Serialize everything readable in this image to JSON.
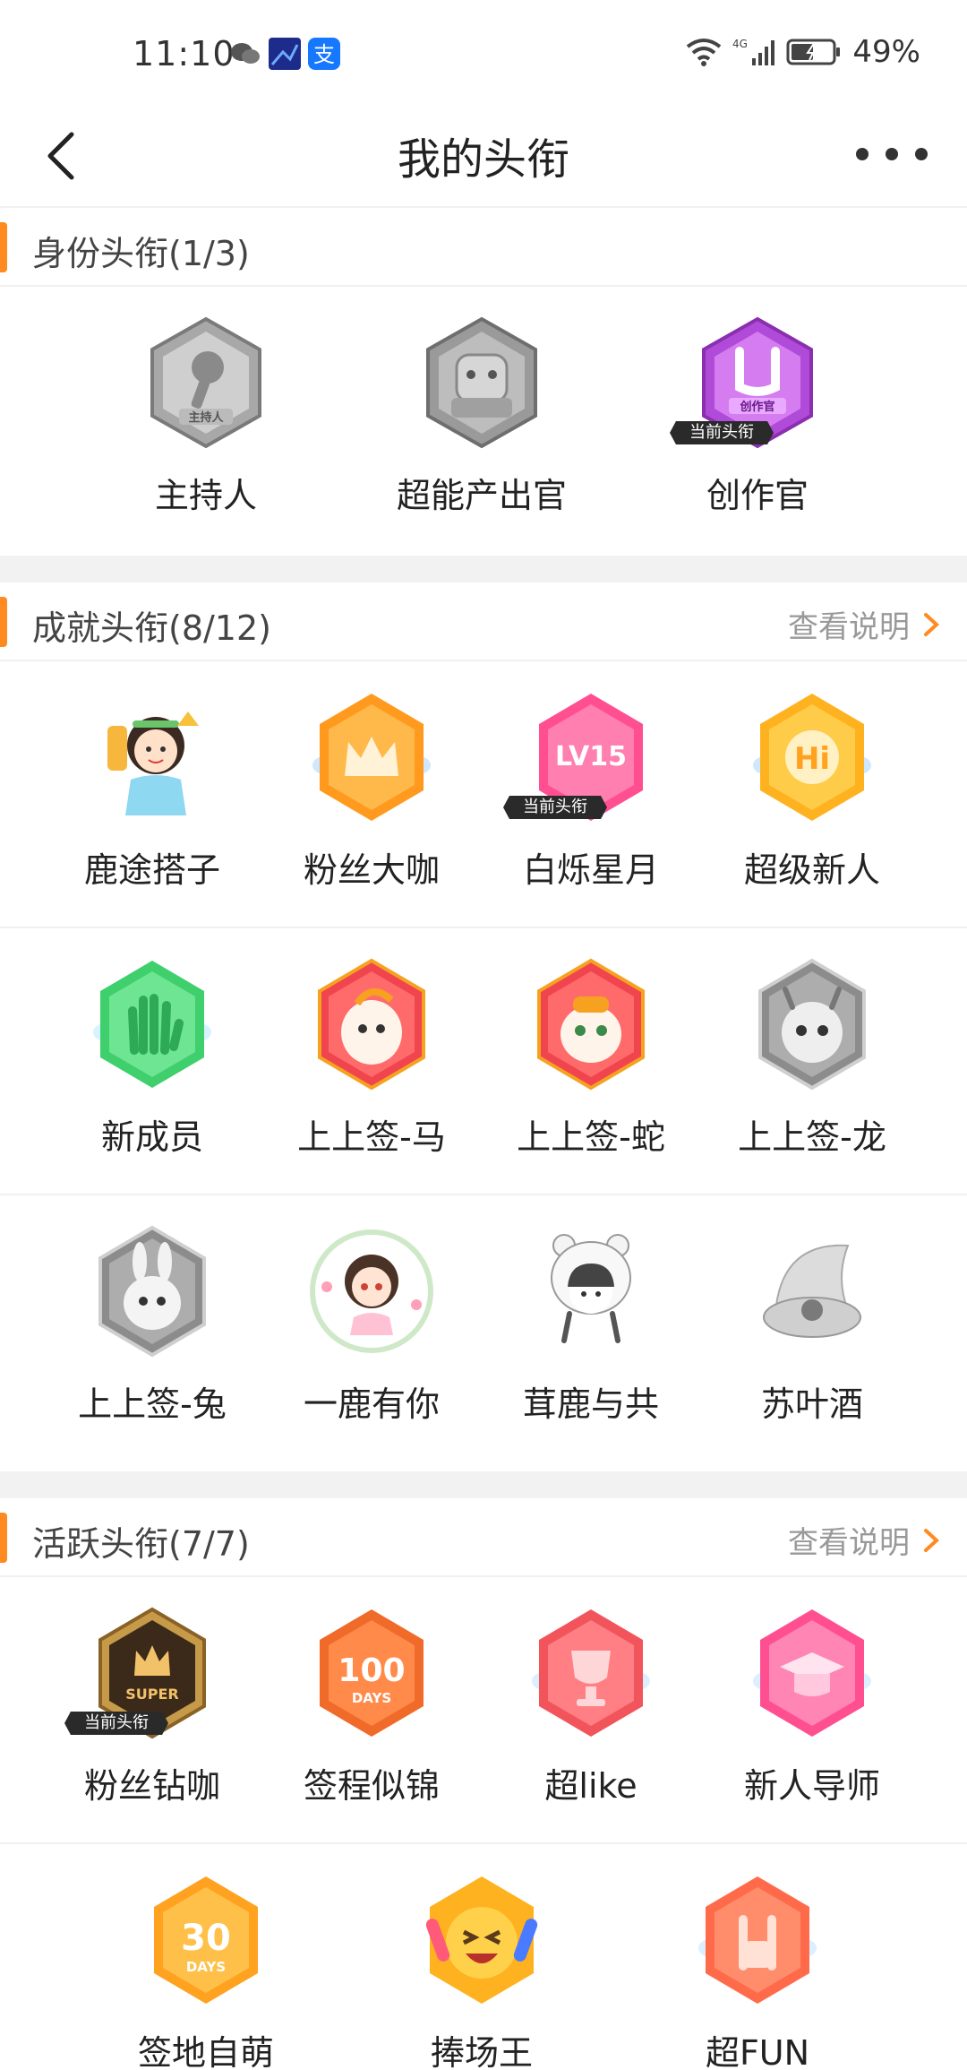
{
  "status_bar": {
    "time": "11:10",
    "battery": "49%",
    "network": "4G"
  },
  "nav": {
    "title": "我的头衔"
  },
  "identity": {
    "title": "身份头衔(1/3)",
    "badges": [
      {
        "label": "主持人",
        "icon": "microphone-badge-icon",
        "icon_text": "主持人"
      },
      {
        "label": "超能产出官",
        "icon": "robot-badge-icon"
      },
      {
        "label": "创作官",
        "icon": "creator-badge-icon",
        "icon_text": "创作官",
        "current": "当前头衔"
      }
    ]
  },
  "achievement": {
    "title": "成就头衔(8/12)",
    "link": "查看说明",
    "badges": [
      {
        "label": "鹿途搭子",
        "icon": "girl-avatar-icon"
      },
      {
        "label": "粉丝大咖",
        "icon": "crown-badge-icon"
      },
      {
        "label": "白烁星月",
        "icon": "level-badge-icon",
        "icon_text": "LV15",
        "current": "当前头衔"
      },
      {
        "label": "超级新人",
        "icon": "hi-badge-icon",
        "icon_text": "Hi"
      },
      {
        "label": "新成员",
        "icon": "hand-badge-icon"
      },
      {
        "label": "上上签-马",
        "icon": "horse-badge-icon"
      },
      {
        "label": "上上签-蛇",
        "icon": "snake-badge-icon"
      },
      {
        "label": "上上签-龙",
        "icon": "dragon-badge-icon"
      },
      {
        "label": "上上签-兔",
        "icon": "rabbit-badge-icon"
      },
      {
        "label": "一鹿有你",
        "icon": "flower-girl-icon"
      },
      {
        "label": "茸鹿与共",
        "icon": "bear-hat-girl-icon"
      },
      {
        "label": "苏叶酒",
        "icon": "pearl-shell-icon"
      }
    ]
  },
  "active": {
    "title": "活跃头衔(7/7)",
    "link": "查看说明",
    "badges": [
      {
        "label": "粉丝钻咖",
        "icon": "super-badge-icon",
        "icon_text": "SUPER",
        "current": "当前头衔"
      },
      {
        "label": "签程似锦",
        "icon": "100-days-badge-icon",
        "icon_text": "100",
        "icon_sub": "DAYS"
      },
      {
        "label": "超like",
        "icon": "trophy-badge-icon"
      },
      {
        "label": "新人导师",
        "icon": "graduation-badge-icon"
      },
      {
        "label": "签地自萌",
        "icon": "30-days-badge-icon",
        "icon_text": "30",
        "icon_sub": "DAYS"
      },
      {
        "label": "捧场王",
        "icon": "laughing-face-icon"
      },
      {
        "label": "超FUN",
        "icon": "rock-hand-badge-icon"
      }
    ]
  },
  "colors": {
    "accent": "#ff8a1f",
    "gray_badge": "#9a9a9a",
    "orange_badge": "#ffa21f",
    "pink_badge": "#ff5a9a",
    "purple_badge": "#b04ad8",
    "green_badge": "#4cd67a",
    "red_badge": "#f2545b"
  }
}
